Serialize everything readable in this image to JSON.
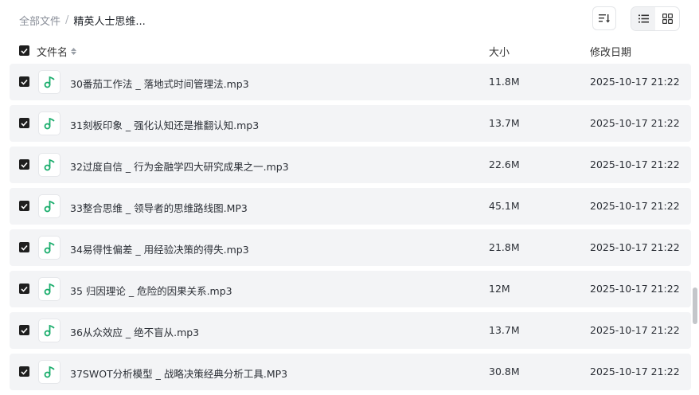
{
  "breadcrumb": {
    "root": "全部文件",
    "separator": "/",
    "current": "精英人士思维..."
  },
  "columns": {
    "name": "文件名",
    "size": "大小",
    "modified": "修改日期"
  },
  "files": [
    {
      "name": "30番茄工作法 _ 落地式时间管理法.mp3",
      "size": "11.8M",
      "modified": "2025-10-17 21:22"
    },
    {
      "name": "31刻板印象 _ 强化认知还是推翻认知.mp3",
      "size": "13.7M",
      "modified": "2025-10-17 21:22"
    },
    {
      "name": "32过度自信 _ 行为金融学四大研究成果之一.mp3",
      "size": "22.6M",
      "modified": "2025-10-17 21:22"
    },
    {
      "name": "33整合思维 _ 领导者的思维路线图.MP3",
      "size": "45.1M",
      "modified": "2025-10-17 21:22"
    },
    {
      "name": "34易得性偏差 _ 用经验决策的得失.mp3",
      "size": "21.8M",
      "modified": "2025-10-17 21:22"
    },
    {
      "name": "35 归因理论 _ 危险的因果关系.mp3",
      "size": "12M",
      "modified": "2025-10-17 21:22"
    },
    {
      "name": "36从众效应 _ 绝不盲从.mp3",
      "size": "13.7M",
      "modified": "2025-10-17 21:22"
    },
    {
      "name": "37SWOT分析模型 _ 战略决策经典分析工具.MP3",
      "size": "30.8M",
      "modified": "2025-10-17 21:22"
    }
  ],
  "colors": {
    "accent": "#1aad6c",
    "row_bg": "#f3f4f6",
    "checkbox": "#1f1f1f"
  }
}
